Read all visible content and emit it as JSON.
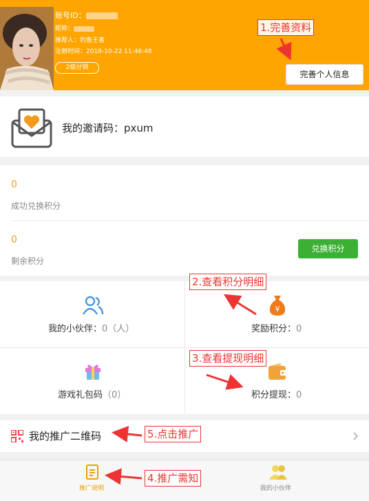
{
  "header": {
    "account_label": "账号ID：",
    "nickname_label": "昵称：",
    "referrer": "推荐人：钓鱼王者",
    "register_time": "注册时间：2018-10-22 11:46:48",
    "level": "2级分销",
    "complete_button": "完善个人信息",
    "colors": {
      "background": "#FFA500"
    }
  },
  "annotations": {
    "a1": "1.完善资料",
    "a2": "2.查看积分明细",
    "a3": "3.查看提现明细",
    "a4": "4.推广需知",
    "a5": "5.点击推广"
  },
  "invite": {
    "text": "我的邀请码：pxum",
    "icon": "envelope-heart-icon"
  },
  "stats": {
    "redeemed_value": "0",
    "redeemed_label": "成功兑换积分",
    "remaining_value": "0",
    "remaining_label": "剩余积分",
    "exchange_button": "兑换积分"
  },
  "grid": {
    "partners_label": "我的小伙伴：",
    "partners_value": "0（人）",
    "reward_label": "奖励积分：",
    "reward_value": "0",
    "gift_label": "游戏礼包码",
    "gift_value": "（0）",
    "withdraw_label": "积分提现：",
    "withdraw_value": "0"
  },
  "promo": {
    "text": "我的推广二维码"
  },
  "tabbar": {
    "tab1": "推广说明",
    "tab2": "我的小伙伴"
  }
}
